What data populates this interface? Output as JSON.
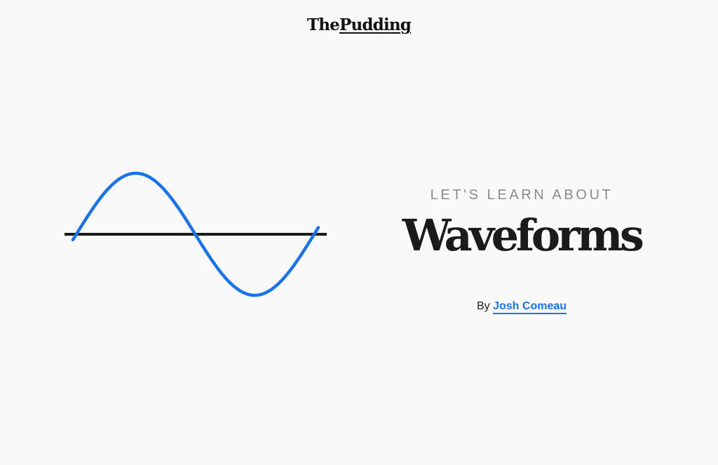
{
  "header": {
    "logo_text_1": "The",
    "logo_text_2": "Pudding"
  },
  "hero": {
    "kicker": "LET'S LEARN ABOUT",
    "title": "Waveforms",
    "byline_prefix": "By",
    "author": "Josh Comeau"
  },
  "figure": {
    "wave_color": "#1b73e8",
    "axis_color": "#1b1b1b",
    "cycles": 1
  },
  "colors": {
    "background": "#f9f9f9",
    "accent": "#1b73e8",
    "text": "#1b1b1b",
    "muted": "#8a8a8a"
  }
}
